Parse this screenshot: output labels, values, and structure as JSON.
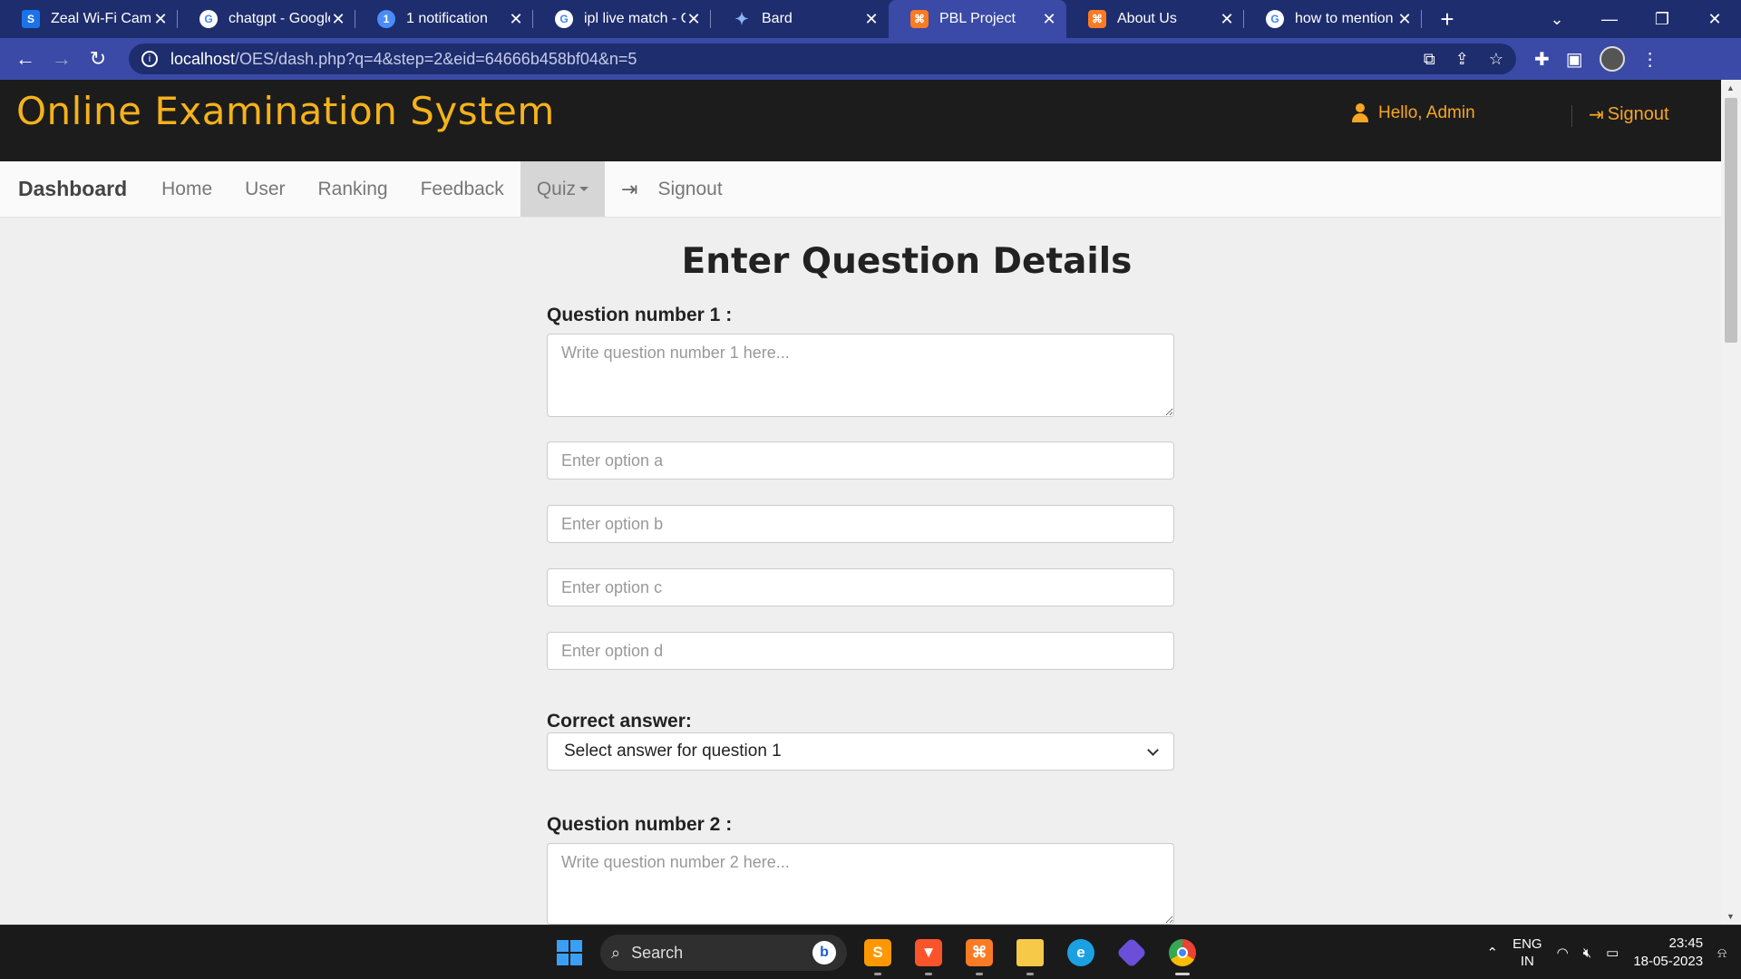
{
  "browser": {
    "tabs": [
      {
        "title": "Zeal Wi-Fi Campus",
        "icon": "s-favicon-icon",
        "glyph": "S",
        "color": "#1a73e8",
        "active": false
      },
      {
        "title": "chatgpt - Google Search",
        "icon": "google-icon",
        "glyph": "G",
        "color": "#ffffff",
        "active": false
      },
      {
        "title": "1 notification",
        "icon": "notification-badge-icon",
        "glyph": "1",
        "color": "#4a8df8",
        "active": false
      },
      {
        "title": "ipl live match - Google Search",
        "icon": "google-icon",
        "glyph": "G",
        "color": "#ffffff",
        "active": false
      },
      {
        "title": "Bard",
        "icon": "bard-sparkle-icon",
        "glyph": "✦",
        "color": "transparent",
        "active": false
      },
      {
        "title": "PBL Project",
        "icon": "xampp-icon",
        "glyph": "⌘",
        "color": "#fb7a24",
        "active": true
      },
      {
        "title": "About Us",
        "icon": "xampp-icon",
        "glyph": "⌘",
        "color": "#fb7a24",
        "active": false
      },
      {
        "title": "how to mention tabs",
        "icon": "google-icon",
        "glyph": "G",
        "color": "#ffffff",
        "active": false
      }
    ],
    "url_host": "localhost",
    "url_path": "/OES/dash.php?q=4&step=2&eid=64666b458bf04&n=5"
  },
  "site": {
    "title": "Online Examination System",
    "hello": "Hello,  Admin",
    "signout": "Signout"
  },
  "nav": {
    "brand": "Dashboard",
    "items": [
      "Home",
      "User",
      "Ranking",
      "Feedback",
      "Quiz",
      "Signout"
    ]
  },
  "form": {
    "heading": "Enter Question Details",
    "q1_label": "Question number 1 :",
    "q1_placeholder": "Write question number 1 here...",
    "option_a": "Enter option a",
    "option_b": "Enter option b",
    "option_c": "Enter option c",
    "option_d": "Enter option d",
    "correct_label": "Correct answer:",
    "correct_select": "Select answer for question 1",
    "q2_label": "Question number 2 :",
    "q2_placeholder": "Write question number 2 here..."
  },
  "taskbar": {
    "search": "Search",
    "lang_1": "ENG",
    "lang_2": "IN",
    "time": "23:45",
    "date": "18-05-2023"
  },
  "colors": {
    "accent": "#f5b21a",
    "header_bg": "#1c1c1c",
    "chrome_tabstrip": "#1e2d6e",
    "chrome_toolbar": "#3a4aa6"
  }
}
